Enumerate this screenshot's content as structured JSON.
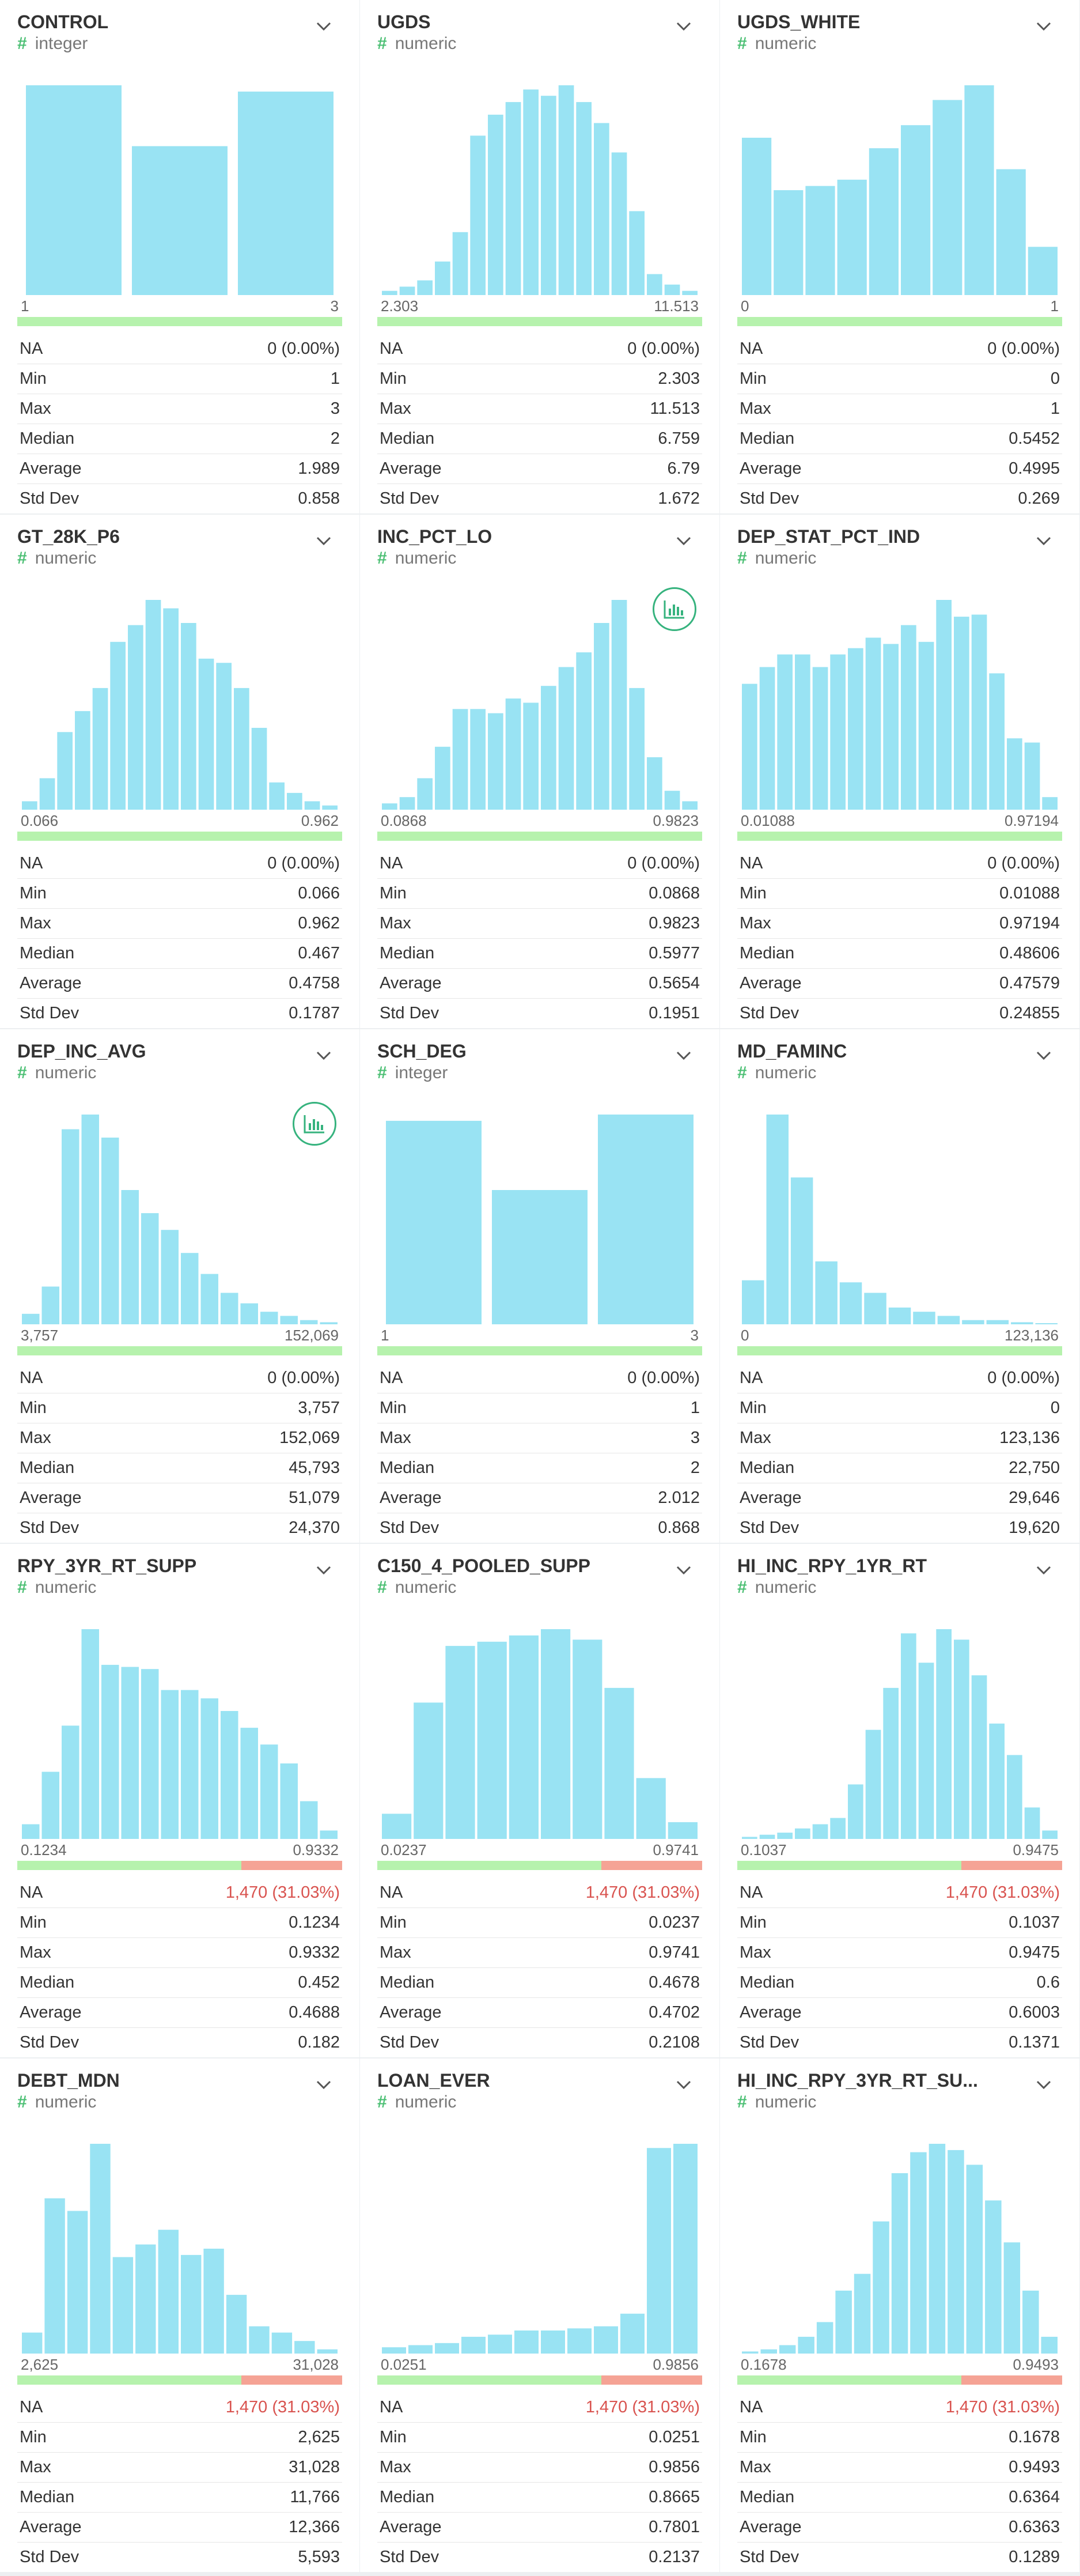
{
  "colors": {
    "bar": "#99e3f3",
    "valid": "#b6f2ad",
    "missing": "#f5a395",
    "type_icon": "#4bbf73",
    "na_warning": "#d9534f"
  },
  "stat_labels": {
    "na": "NA",
    "min": "Min",
    "max": "Max",
    "median": "Median",
    "average": "Average",
    "std_dev": "Std Dev"
  },
  "columns": [
    {
      "name": "CONTROL",
      "type": "integer",
      "type_icon": "#",
      "hist": [
        1.0,
        0.71,
        0.97
      ],
      "range": {
        "min": "1",
        "max": "3"
      },
      "na_fraction": 0.0,
      "chart_button": false,
      "stats": {
        "na": "0 (0.00%)",
        "min": "1",
        "max": "3",
        "median": "2",
        "average": "1.989",
        "std_dev": "0.858"
      }
    },
    {
      "name": "UGDS",
      "type": "numeric",
      "type_icon": "#",
      "hist": [
        0.02,
        0.04,
        0.07,
        0.16,
        0.3,
        0.76,
        0.86,
        0.92,
        0.98,
        0.95,
        1.0,
        0.92,
        0.82,
        0.68,
        0.4,
        0.1,
        0.05,
        0.02
      ],
      "range": {
        "min": "2.303",
        "max": "11.513"
      },
      "na_fraction": 0.0,
      "chart_button": false,
      "stats": {
        "na": "0 (0.00%)",
        "min": "2.303",
        "max": "11.513",
        "median": "6.759",
        "average": "6.79",
        "std_dev": "1.672"
      }
    },
    {
      "name": "UGDS_WHITE",
      "type": "numeric",
      "type_icon": "#",
      "hist": [
        0.75,
        0.5,
        0.52,
        0.55,
        0.7,
        0.81,
        0.93,
        1.0,
        0.6,
        0.23
      ],
      "range": {
        "min": "0",
        "max": "1"
      },
      "na_fraction": 0.0,
      "chart_button": false,
      "stats": {
        "na": "0 (0.00%)",
        "min": "0",
        "max": "1",
        "median": "0.5452",
        "average": "0.4995",
        "std_dev": "0.269"
      }
    },
    {
      "name": "GT_28K_P6",
      "type": "numeric",
      "type_icon": "#",
      "hist": [
        0.04,
        0.15,
        0.37,
        0.47,
        0.58,
        0.8,
        0.88,
        1.0,
        0.96,
        0.89,
        0.72,
        0.7,
        0.58,
        0.39,
        0.13,
        0.08,
        0.04,
        0.02
      ],
      "range": {
        "min": "0.066",
        "max": "0.962"
      },
      "na_fraction": 0.0,
      "chart_button": false,
      "stats": {
        "na": "0 (0.00%)",
        "min": "0.066",
        "max": "0.962",
        "median": "0.467",
        "average": "0.4758",
        "std_dev": "0.1787"
      }
    },
    {
      "name": "INC_PCT_LO",
      "type": "numeric",
      "type_icon": "#",
      "hist": [
        0.03,
        0.06,
        0.15,
        0.3,
        0.48,
        0.48,
        0.46,
        0.53,
        0.51,
        0.59,
        0.68,
        0.75,
        0.89,
        1.0,
        0.58,
        0.25,
        0.09,
        0.04
      ],
      "range": {
        "min": "0.0868",
        "max": "0.9823"
      },
      "na_fraction": 0.0,
      "chart_button": true,
      "stats": {
        "na": "0 (0.00%)",
        "min": "0.0868",
        "max": "0.9823",
        "median": "0.5977",
        "average": "0.5654",
        "std_dev": "0.1951"
      }
    },
    {
      "name": "DEP_STAT_PCT_IND",
      "type": "numeric",
      "type_icon": "#",
      "hist": [
        0.6,
        0.68,
        0.74,
        0.74,
        0.68,
        0.74,
        0.77,
        0.82,
        0.79,
        0.88,
        0.8,
        1.0,
        0.92,
        0.93,
        0.65,
        0.34,
        0.32,
        0.06
      ],
      "range": {
        "min": "0.01088",
        "max": "0.97194"
      },
      "na_fraction": 0.0,
      "chart_button": false,
      "stats": {
        "na": "0 (0.00%)",
        "min": "0.01088",
        "max": "0.97194",
        "median": "0.48606",
        "average": "0.47579",
        "std_dev": "0.24855"
      }
    },
    {
      "name": "DEP_INC_AVG",
      "type": "numeric",
      "type_icon": "#",
      "hist": [
        0.05,
        0.18,
        0.93,
        1.0,
        0.89,
        0.64,
        0.53,
        0.45,
        0.34,
        0.24,
        0.15,
        0.1,
        0.06,
        0.04,
        0.02,
        0.01
      ],
      "range": {
        "min": "3,757",
        "max": "152,069"
      },
      "na_fraction": 0.0,
      "chart_button": true,
      "stats": {
        "na": "0 (0.00%)",
        "min": "3,757",
        "max": "152,069",
        "median": "45,793",
        "average": "51,079",
        "std_dev": "24,370"
      }
    },
    {
      "name": "SCH_DEG",
      "type": "integer",
      "type_icon": "#",
      "hist": [
        0.97,
        0.64,
        1.0
      ],
      "range": {
        "min": "1",
        "max": "3"
      },
      "na_fraction": 0.0,
      "chart_button": false,
      "stats": {
        "na": "0 (0.00%)",
        "min": "1",
        "max": "3",
        "median": "2",
        "average": "2.012",
        "std_dev": "0.868"
      }
    },
    {
      "name": "MD_FAMINC",
      "type": "numeric",
      "type_icon": "#",
      "hist": [
        0.21,
        1.0,
        0.7,
        0.3,
        0.2,
        0.15,
        0.08,
        0.06,
        0.04,
        0.02,
        0.02,
        0.01,
        0.005
      ],
      "range": {
        "min": "0",
        "max": "123,136"
      },
      "na_fraction": 0.0,
      "chart_button": false,
      "stats": {
        "na": "0 (0.00%)",
        "min": "0",
        "max": "123,136",
        "median": "22,750",
        "average": "29,646",
        "std_dev": "19,620"
      }
    },
    {
      "name": "RPY_3YR_RT_SUPP",
      "type": "numeric",
      "type_icon": "#",
      "hist": [
        0.07,
        0.32,
        0.54,
        1.0,
        0.83,
        0.82,
        0.81,
        0.71,
        0.71,
        0.67,
        0.61,
        0.53,
        0.45,
        0.36,
        0.18,
        0.04
      ],
      "range": {
        "min": "0.1234",
        "max": "0.9332"
      },
      "na_fraction": 0.3103,
      "chart_button": false,
      "stats": {
        "na": "1,470 (31.03%)",
        "min": "0.1234",
        "max": "0.9332",
        "median": "0.452",
        "average": "0.4688",
        "std_dev": "0.182"
      }
    },
    {
      "name": "C150_4_POOLED_SUPP",
      "type": "numeric",
      "type_icon": "#",
      "hist": [
        0.12,
        0.65,
        0.92,
        0.94,
        0.97,
        1.0,
        0.95,
        0.72,
        0.29,
        0.08
      ],
      "range": {
        "min": "0.0237",
        "max": "0.9741"
      },
      "na_fraction": 0.3103,
      "chart_button": false,
      "stats": {
        "na": "1,470 (31.03%)",
        "min": "0.0237",
        "max": "0.9741",
        "median": "0.4678",
        "average": "0.4702",
        "std_dev": "0.2108"
      }
    },
    {
      "name": "HI_INC_RPY_1YR_RT",
      "type": "numeric",
      "type_icon": "#",
      "hist": [
        0.01,
        0.02,
        0.03,
        0.05,
        0.07,
        0.1,
        0.26,
        0.52,
        0.72,
        0.98,
        0.84,
        1.0,
        0.95,
        0.78,
        0.55,
        0.4,
        0.15,
        0.04
      ],
      "range": {
        "min": "0.1037",
        "max": "0.9475"
      },
      "na_fraction": 0.3103,
      "chart_button": false,
      "stats": {
        "na": "1,470 (31.03%)",
        "min": "0.1037",
        "max": "0.9475",
        "median": "0.6",
        "average": "0.6003",
        "std_dev": "0.1371"
      }
    },
    {
      "name": "DEBT_MDN",
      "type": "numeric",
      "type_icon": "#",
      "hist": [
        0.1,
        0.74,
        0.68,
        1.0,
        0.46,
        0.52,
        0.59,
        0.47,
        0.5,
        0.28,
        0.13,
        0.1,
        0.06,
        0.02
      ],
      "range": {
        "min": "2,625",
        "max": "31,028"
      },
      "na_fraction": 0.3103,
      "chart_button": false,
      "stats": {
        "na": "1,470 (31.03%)",
        "min": "2,625",
        "max": "31,028",
        "median": "11,766",
        "average": "12,366",
        "std_dev": "5,593"
      }
    },
    {
      "name": "LOAN_EVER",
      "type": "numeric",
      "type_icon": "#",
      "hist": [
        0.03,
        0.04,
        0.05,
        0.08,
        0.09,
        0.11,
        0.11,
        0.12,
        0.13,
        0.19,
        0.98,
        1.0
      ],
      "range": {
        "min": "0.0251",
        "max": "0.9856"
      },
      "na_fraction": 0.3103,
      "chart_button": false,
      "stats": {
        "na": "1,470 (31.03%)",
        "min": "0.0251",
        "max": "0.9856",
        "median": "0.8665",
        "average": "0.7801",
        "std_dev": "0.2137"
      }
    },
    {
      "name": "HI_INC_RPY_3YR_RT_SU...",
      "type": "numeric",
      "type_icon": "#",
      "hist": [
        0.01,
        0.02,
        0.04,
        0.08,
        0.15,
        0.3,
        0.38,
        0.63,
        0.86,
        0.96,
        1.0,
        0.97,
        0.9,
        0.73,
        0.53,
        0.3,
        0.08
      ],
      "range": {
        "min": "0.1678",
        "max": "0.9493"
      },
      "na_fraction": 0.3103,
      "chart_button": false,
      "stats": {
        "na": "1,470 (31.03%)",
        "min": "0.1678",
        "max": "0.9493",
        "median": "0.6364",
        "average": "0.6363",
        "std_dev": "0.1289"
      }
    }
  ]
}
